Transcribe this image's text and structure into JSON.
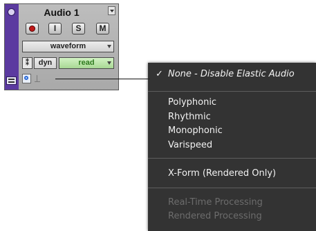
{
  "track": {
    "name": "Audio 1",
    "buttons": {
      "input": "I",
      "solo": "S",
      "mute": "M"
    },
    "view_selector": "waveform",
    "link_glyph": "⁑",
    "dynamics": "dyn",
    "automation_mode": "read"
  },
  "menu": {
    "checked_mark": "✓",
    "items": {
      "none": "None - Disable Elastic Audio",
      "polyphonic": "Polyphonic",
      "rhythmic": "Rhythmic",
      "monophonic": "Monophonic",
      "varispeed": "Varispeed",
      "xform": "X-Form (Rendered Only)",
      "realtime": "Real-Time Processing",
      "rendered": "Rendered Processing"
    }
  },
  "colors": {
    "track_strip": "#5b3aa0",
    "record": "#c01818",
    "read_mode": "#a8d894",
    "menu_bg": "#262626",
    "elastic_icon": "#2a6ad8"
  },
  "icons": [
    "track-color-indicator",
    "record-icon",
    "elastic-audio-icon",
    "warp-indicator-icon",
    "link-icon",
    "track-type-icon"
  ]
}
